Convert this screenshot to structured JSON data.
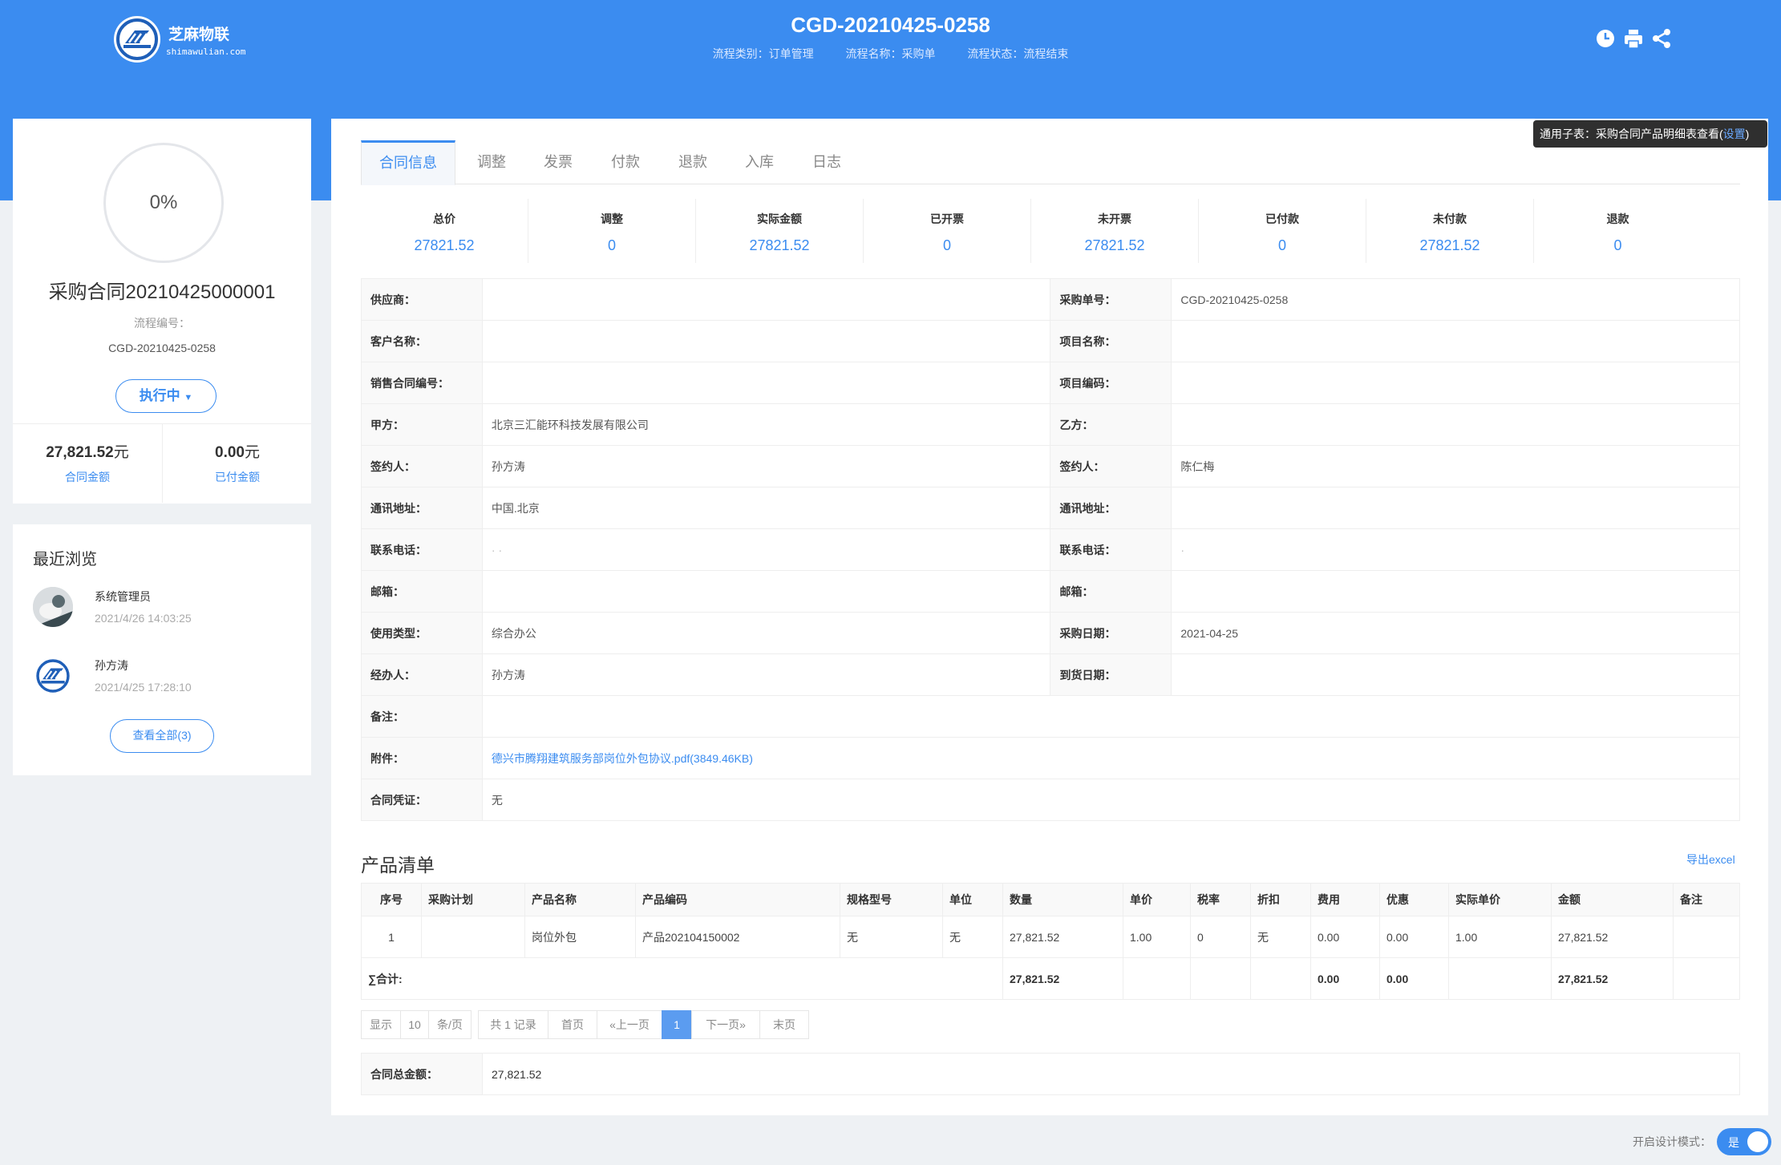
{
  "brand": {
    "name": "芝麻物联",
    "domain": "shimawulian.com"
  },
  "header": {
    "title": "CGD-20210425-0258",
    "meta": {
      "category": "流程类别：订单管理",
      "flow_name": "流程名称：采购单",
      "flow_status": "流程状态：流程结束"
    },
    "icons": [
      "clock-icon",
      "print-icon",
      "share-icon"
    ]
  },
  "summary_card": {
    "progress": "0%",
    "contract_title": "采购合同20210425000001",
    "flow_label": "流程编号：",
    "flow_no": "CGD-20210425-0258",
    "status_label": "执行中",
    "contract_amount": "27,821.52",
    "contract_amount_unit": "元",
    "contract_amount_label": "合同金额",
    "paid_amount": "0.00",
    "paid_amount_unit": "元",
    "paid_amount_label": "已付金额"
  },
  "recent": {
    "title": "最近浏览",
    "items": [
      {
        "name": "系统管理员",
        "time": "2021/4/26 14:03:25"
      },
      {
        "name": "孙方涛",
        "time": "2021/4/25 17:28:10"
      }
    ],
    "view_all": "查看全部(3)"
  },
  "tooltip": {
    "text": "通用子表：采购合同产品明细表查看(",
    "link": "设置",
    "close": ")"
  },
  "tabs": [
    "合同信息",
    "调整",
    "发票",
    "付款",
    "退款",
    "入库",
    "日志"
  ],
  "stats": [
    {
      "label": "总价",
      "value": "27821.52"
    },
    {
      "label": "调整",
      "value": "0"
    },
    {
      "label": "实际金额",
      "value": "27821.52"
    },
    {
      "label": "已开票",
      "value": "0"
    },
    {
      "label": "未开票",
      "value": "27821.52"
    },
    {
      "label": "已付款",
      "value": "0"
    },
    {
      "label": "未付款",
      "value": "27821.52"
    },
    {
      "label": "退款",
      "value": "0"
    }
  ],
  "info": {
    "supplier_label": "供应商：",
    "supplier": "",
    "po_no_label": "采购单号：",
    "po_no": "CGD-20210425-0258",
    "customer_label": "客户名称：",
    "customer": "",
    "project_name_label": "项目名称：",
    "project_name": "",
    "sales_no_label": "销售合同编号：",
    "sales_no": "",
    "project_code_label": "项目编码：",
    "project_code": "",
    "party_a_label": "甲方：",
    "party_a": "北京三汇能环科技发展有限公司",
    "party_b_label": "乙方：",
    "party_b": "",
    "signer_a_label": "签约人：",
    "signer_a": "孙方涛",
    "signer_b_label": "签约人：",
    "signer_b": "陈仁梅",
    "addr_a_label": "通讯地址：",
    "addr_a": "中国.北京",
    "addr_b_label": "通讯地址：",
    "addr_b": "",
    "phone_a_label": "联系电话：",
    "phone_a": "·              ·",
    "phone_b_label": "联系电话：",
    "phone_b": "·",
    "email_a_label": "邮箱：",
    "email_a": "",
    "email_b_label": "邮箱：",
    "email_b": "",
    "use_type_label": "使用类型：",
    "use_type": "综合办公",
    "po_date_label": "采购日期：",
    "po_date": "2021-04-25",
    "handler_label": "经办人：",
    "handler": "孙方涛",
    "arrival_label": "到货日期：",
    "arrival": "",
    "remark_label": "备注：",
    "remark": "",
    "attachment_label": "附件：",
    "attachment": "德兴市腾翔建筑服务部岗位外包协议.pdf(3849.46KB)",
    "voucher_label": "合同凭证：",
    "voucher": "无"
  },
  "products": {
    "title": "产品清单",
    "export": "导出excel",
    "headers": [
      "序号",
      "采购计划",
      "产品名称",
      "产品编码",
      "规格型号",
      "单位",
      "数量",
      "单价",
      "税率",
      "折扣",
      "费用",
      "优惠",
      "实际单价",
      "金额",
      "备注"
    ],
    "rows": [
      [
        "1",
        "",
        "岗位外包",
        "产品202104150002",
        "无",
        "无",
        "27,821.52",
        "1.00",
        "0",
        "无",
        "0.00",
        "0.00",
        "1.00",
        "27,821.52",
        ""
      ]
    ],
    "total_label": "∑合计:",
    "totals": {
      "qty": "27,821.52",
      "fee": "0.00",
      "discount": "0.00",
      "amount": "27,821.52"
    }
  },
  "pager": {
    "show": "显示",
    "size": "10",
    "per_page": "条/页",
    "total": "共 1 记录",
    "first": "首页",
    "prev": "«上一页",
    "current": "1",
    "next": "下一页»",
    "last": "末页"
  },
  "contract_total": {
    "label": "合同总金额：",
    "value": "27,821.52"
  },
  "design_mode": {
    "label": "开启设计模式：",
    "value": "是"
  }
}
